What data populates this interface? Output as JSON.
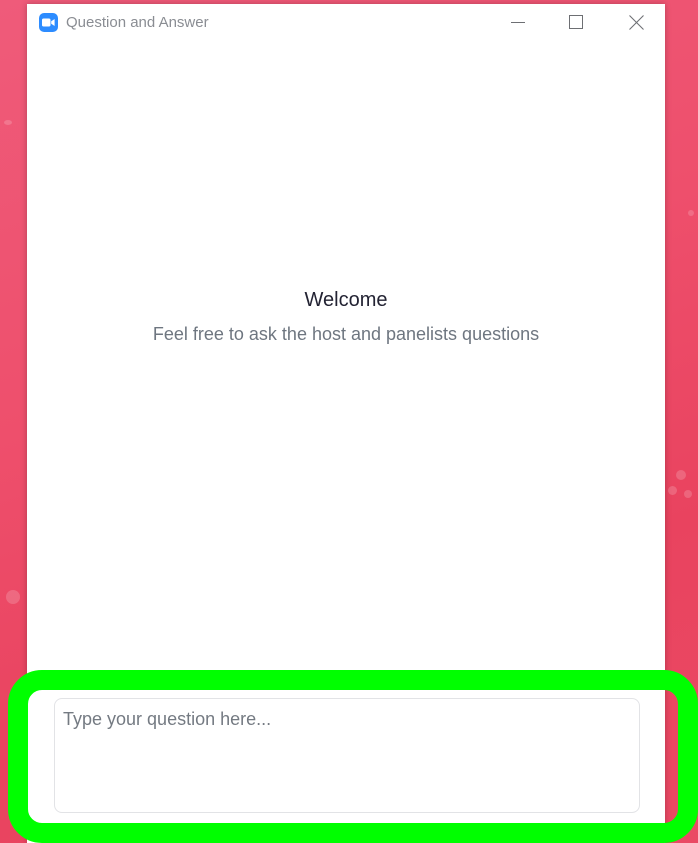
{
  "window": {
    "title": "Question and Answer",
    "app_icon": "zoom-camera-icon",
    "controls": {
      "minimize_icon": "minimize-icon",
      "maximize_icon": "maximize-icon",
      "close_icon": "close-icon"
    }
  },
  "main": {
    "welcome_title": "Welcome",
    "welcome_subtitle": "Feel free to ask the host and panelists questions"
  },
  "question_box": {
    "value": "",
    "placeholder": "Type your question here..."
  },
  "colors": {
    "accent_blue": "#2d8cff",
    "highlight_green": "#00ff00",
    "desktop_pink": "#ee4f6c"
  }
}
